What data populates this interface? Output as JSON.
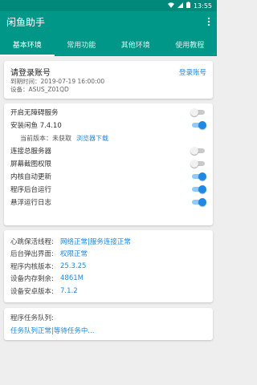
{
  "status_bar": {
    "time": "13:55"
  },
  "app": {
    "title": "闲鱼助手"
  },
  "tabs": [
    {
      "label": "基本环境",
      "active": true
    },
    {
      "label": "常用功能",
      "active": false
    },
    {
      "label": "其他环境",
      "active": false
    },
    {
      "label": "使用教程",
      "active": false
    }
  ],
  "login": {
    "title": "请登录账号",
    "expire": "到期时间：2019-07-19 16:00:00",
    "device": "设备：ASUS_Z01QD",
    "link": "登录账号"
  },
  "settings": {
    "accessibility": {
      "label": "开启无障碍服务",
      "on": false
    },
    "install": {
      "label": "安装闲鱼 7.4.10",
      "on": true
    },
    "current_version": {
      "label": "当前版本：未获取",
      "link": "浏览器下载"
    },
    "connect_server": {
      "label": "连接总服务器",
      "on": false
    },
    "screenshot": {
      "label": "屏幕截图权限",
      "on": false
    },
    "auto_update": {
      "label": "内核自动更新",
      "on": true
    },
    "background_run": {
      "label": "程序后台运行",
      "on": true
    },
    "float_log": {
      "label": "悬浮运行日志",
      "on": true
    }
  },
  "info": [
    {
      "key": "心跳保活线程:",
      "value": "网络正常|服务连接正常"
    },
    {
      "key": "后台弹出界面:",
      "value": "权限正常"
    },
    {
      "key": "程序内核版本:",
      "value": "25.3.25"
    },
    {
      "key": "设备内存剩余:",
      "value": "4861M"
    },
    {
      "key": "设备安卓版本:",
      "value": "7.1.2"
    }
  ],
  "tasks": {
    "key": "程序任务队列:",
    "value": "任务队列正常|等待任务中..."
  },
  "colors": {
    "primary": "#009688",
    "accent": "#1e88e5"
  }
}
